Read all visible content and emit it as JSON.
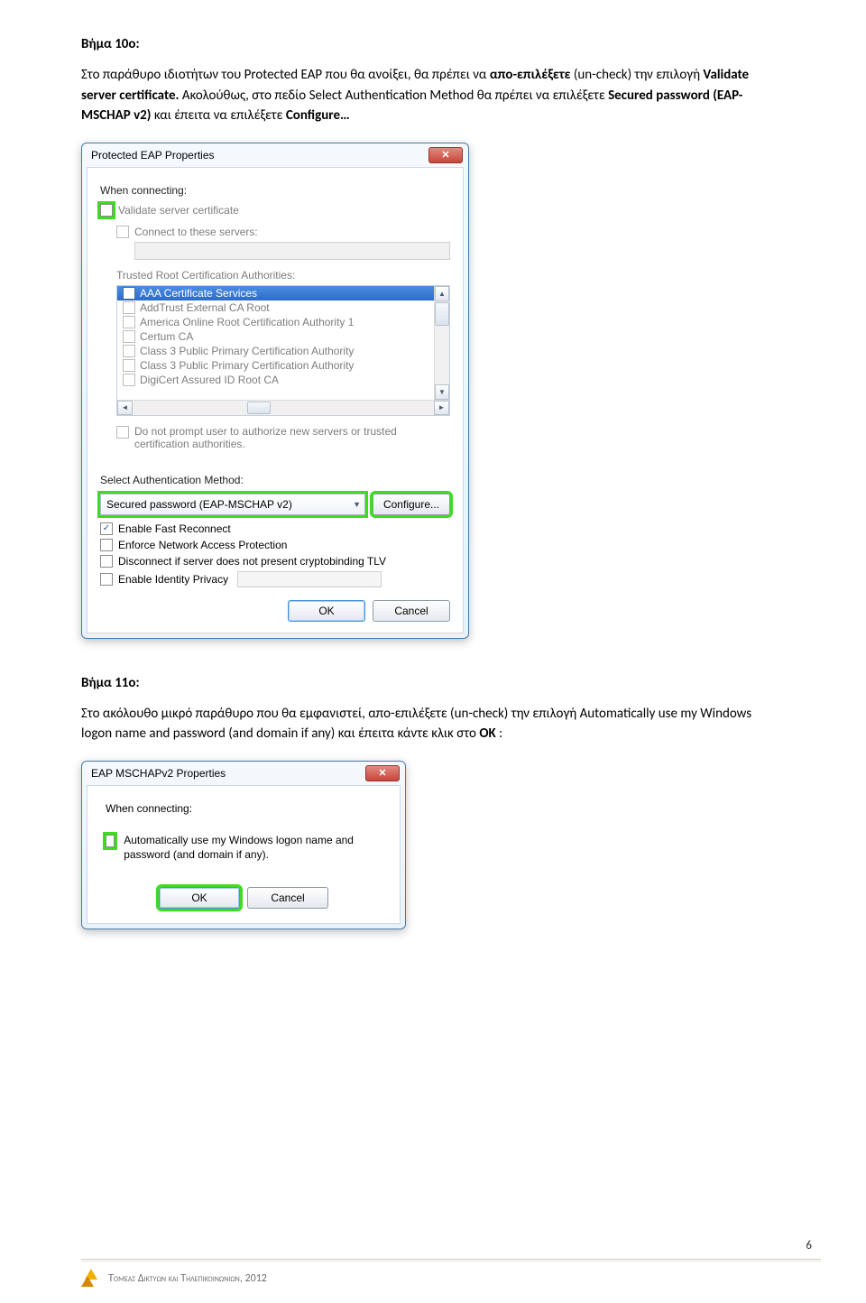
{
  "step10": {
    "title": "Βήμα 10o:",
    "body_parts": [
      "Στο παράθυρο ιδιοτήτων του Protected EAP που θα ανοίξει, θα πρέπει να ",
      "απο-επιλέξετε",
      " (un-check) την επιλογή ",
      "Validate server certificate.",
      " Ακολούθως, στο πεδίο Select Authentication Method θα πρέπει να επιλέξετε ",
      "Secured password (EAP-MSCHAP v2)",
      " και έπειτα να επιλέξετε ",
      "Configure…"
    ]
  },
  "peap": {
    "title": "Protected EAP Properties",
    "when_label": "When connecting:",
    "validate_label": "Validate server certificate",
    "connect_label": "Connect to these servers:",
    "trusted_label": "Trusted Root Certification Authorities:",
    "ca_list": [
      "AAA Certificate Services",
      "AddTrust External CA Root",
      "America Online Root Certification Authority 1",
      "Certum CA",
      "Class 3 Public Primary Certification Authority",
      "Class 3 Public Primary Certification Authority",
      "DigiCert Assured ID Root CA"
    ],
    "noprompt_label": "Do not prompt user to authorize new servers or trusted certification authorities.",
    "select_method_label": "Select Authentication Method:",
    "method_value": "Secured password (EAP-MSCHAP v2)",
    "configure_btn": "Configure...",
    "opts": {
      "fast": "Enable Fast Reconnect",
      "nap": "Enforce Network Access Protection",
      "crypto": "Disconnect if server does not present cryptobinding TLV",
      "idpriv": "Enable Identity Privacy"
    },
    "ok": "OK",
    "cancel": "Cancel"
  },
  "step11": {
    "title": "Βήμα 11o:",
    "body_parts": [
      "Στο ακόλουθο μικρό παράθυρο που θα εμφανιστεί, απο-επιλέξετε (un-check) την επιλογή Automatically use my Windows logon name and password (and domain if any) και έπειτα κάντε κλικ στο ",
      "ΟΚ",
      ":"
    ]
  },
  "mschap": {
    "title": "EAP MSCHAPv2 Properties",
    "when_label": "When connecting:",
    "auto_label": "Automatically use my Windows logon name and password (and domain if any).",
    "ok": "OK",
    "cancel": "Cancel"
  },
  "footer": {
    "text": "Τομεας Δικτυων και Τηλεπικοινωνιων, 2012",
    "page": "6"
  }
}
